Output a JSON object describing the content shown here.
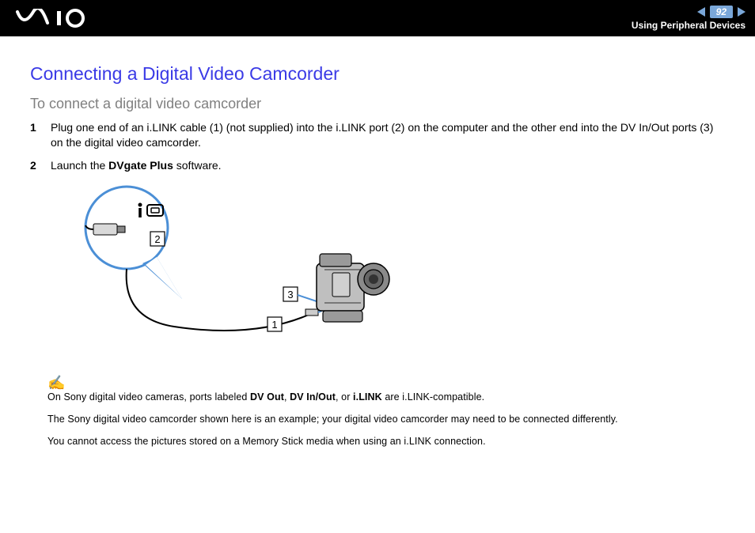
{
  "header": {
    "page_number": "92",
    "breadcrumb": "Using Peripheral Devices"
  },
  "title": "Connecting a Digital Video Camcorder",
  "subhead": "To connect a digital video camcorder",
  "steps": [
    {
      "num": "1",
      "text_a": "Plug one end of an i.LINK cable (1) (not supplied) into the i.LINK port (2) on the computer and the other end into the DV In/Out ports (3) on the digital video camcorder."
    },
    {
      "num": "2",
      "text_a": "Launch the ",
      "bold": "DVgate Plus",
      "text_b": " software."
    }
  ],
  "figure": {
    "labels": {
      "one": "1",
      "two": "2",
      "three": "3"
    }
  },
  "notes": {
    "line1_a": "On Sony digital video cameras, ports labeled ",
    "line1_b1": "DV Out",
    "line1_c1": ", ",
    "line1_b2": "DV In/Out",
    "line1_c2": ", or ",
    "line1_b3": "i.LINK",
    "line1_d": " are i.LINK-compatible.",
    "line2": "The Sony digital video camcorder shown here is an example; your digital video camcorder may need to be connected differently.",
    "line3": "You cannot access the pictures stored on a Memory Stick media when using an i.LINK connection."
  }
}
